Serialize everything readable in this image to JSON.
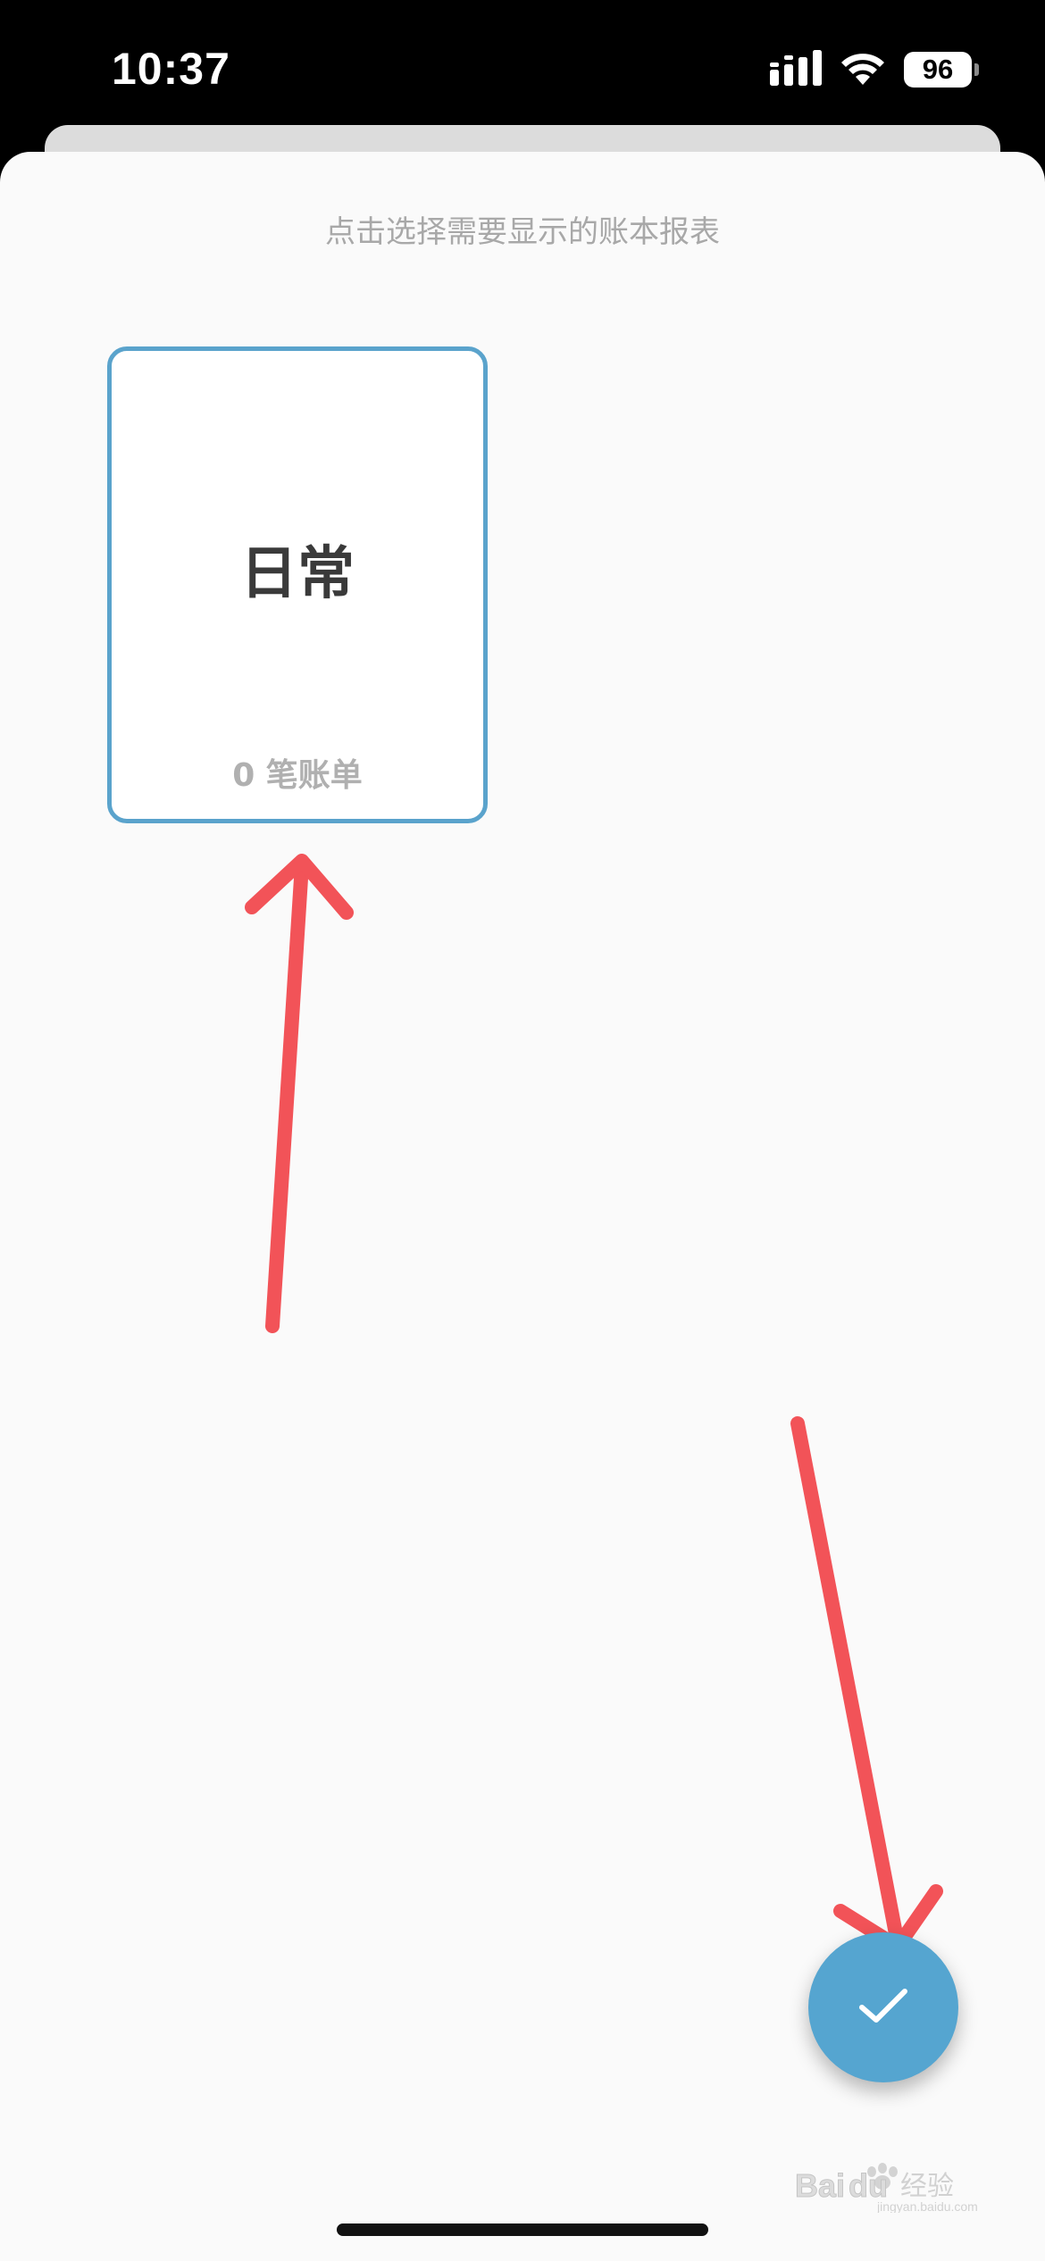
{
  "status_bar": {
    "time": "10:37",
    "battery_level": "96",
    "signal_icon": "cellular-signal-icon",
    "wifi_icon": "wifi-icon"
  },
  "sheet": {
    "hint": "点击选择需要显示的账本报表"
  },
  "ledgers": [
    {
      "name": "日常",
      "count_label": "0 笔账单",
      "selected": true
    }
  ],
  "fab": {
    "icon": "checkmark-icon"
  },
  "annotations": {
    "arrow_color": "#f25358"
  },
  "watermark": {
    "text": "Baidu经验",
    "subtext": "jingyan.baidu.com"
  },
  "colors": {
    "accent": "#55a5d0",
    "card_border": "#5aa3cc",
    "background": "#fafafa"
  }
}
